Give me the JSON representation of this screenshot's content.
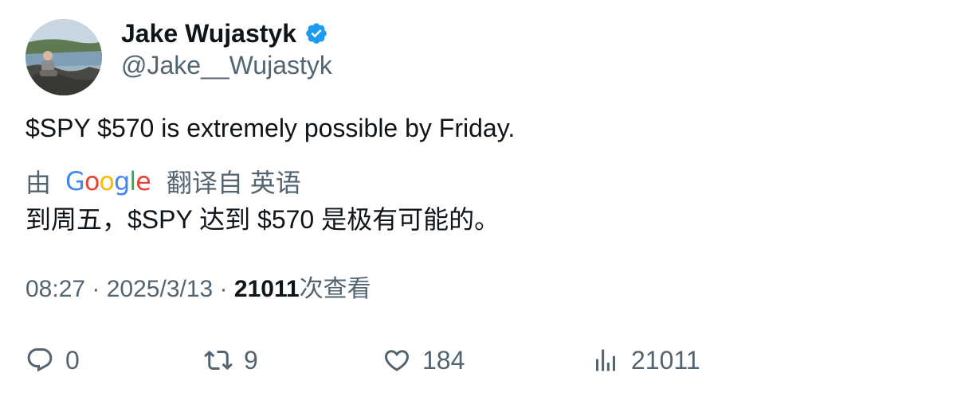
{
  "author": {
    "name": "Jake Wujastyk",
    "handle": "@Jake__Wujastyk",
    "verified": true
  },
  "tweet": {
    "text": "$SPY $570 is extremely possible by Friday."
  },
  "translation": {
    "prefix": "由",
    "provider": "Google",
    "suffix": "翻译自 英语",
    "text": "到周五，$SPY 达到 $570 是极有可能的。"
  },
  "meta": {
    "time": "08:27",
    "separator": " · ",
    "date": "2025/3/13",
    "views_count": "21011",
    "views_label": "次查看"
  },
  "actions": {
    "replies": "0",
    "retweets": "9",
    "likes": "184",
    "views": "21011"
  },
  "colors": {
    "verified": "#1d9bf0",
    "text": "#0f1419",
    "muted": "#536471"
  }
}
